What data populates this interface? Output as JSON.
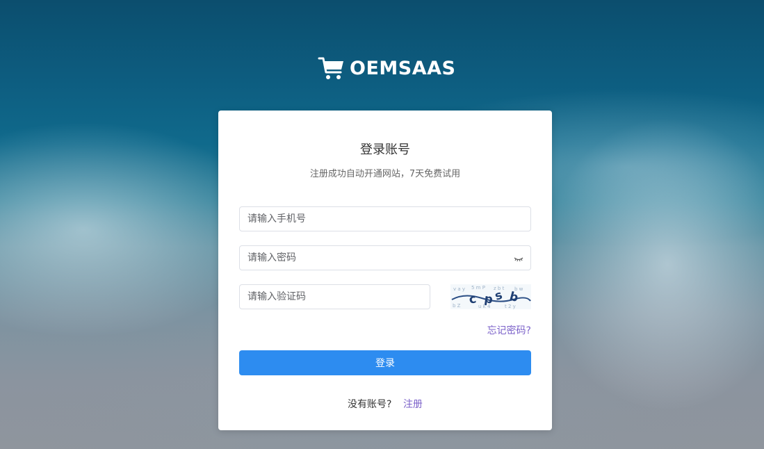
{
  "brand": {
    "name": "OEMSAAS",
    "logo_icon": "shopping-cart-icon"
  },
  "login": {
    "title": "登录账号",
    "subtitle": "注册成功自动开通网站，7天免费试用",
    "phone_placeholder": "请输入手机号",
    "password_placeholder": "请输入密码",
    "code_placeholder": "请输入验证码",
    "captcha_text": "cpsb",
    "forgot_label": "忘记密码?",
    "submit_label": "登录",
    "no_account_text": "没有账号?",
    "register_label": "注册"
  },
  "colors": {
    "primary": "#2d8cf0",
    "link": "#7b61c9"
  }
}
